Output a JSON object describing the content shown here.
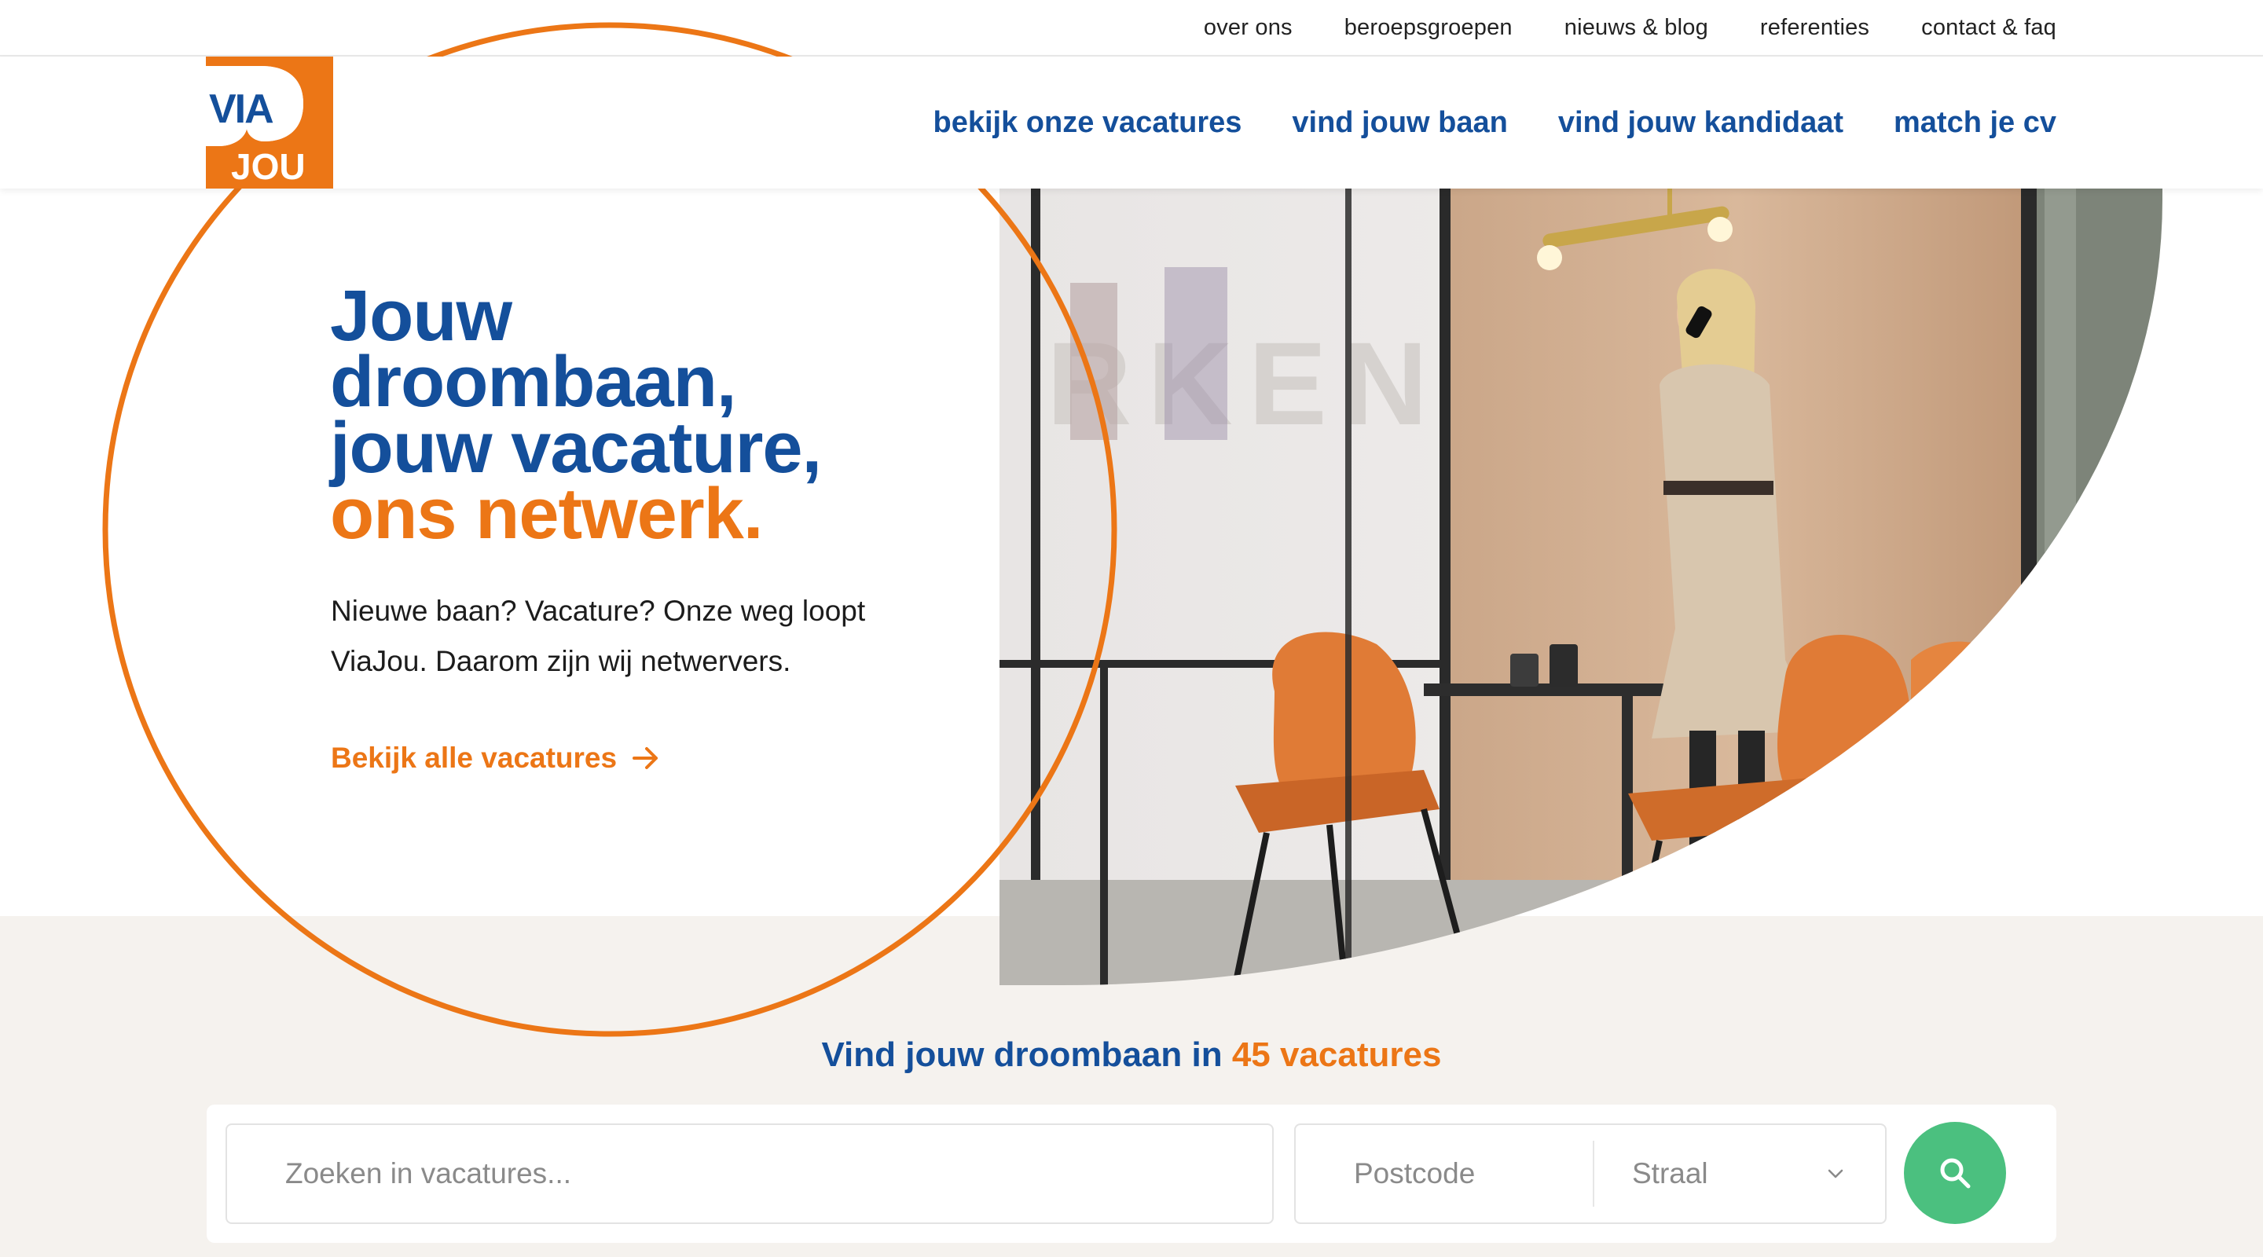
{
  "top_nav": [
    "over ons",
    "beroepsgroepen",
    "nieuws & blog",
    "referenties",
    "contact & faq"
  ],
  "main_nav": [
    "bekijk onze vacatures",
    "vind jouw baan",
    "vind jouw kandidaat",
    "match je cv"
  ],
  "logo": {
    "top": "VIA",
    "bottom": "JOU"
  },
  "hero": {
    "headline_blue": [
      "Jouw",
      "droombaan,",
      "jouw vacature,"
    ],
    "headline_orange": "ons netwerk.",
    "intro_line1": "Nieuwe baan? Vacature? Onze weg loopt",
    "intro_line2": "ViaJou. Daarom zijn wij netwervers.",
    "cta": "Bekijk alle vacatures"
  },
  "search": {
    "title_prefix": "Vind jouw droombaan in",
    "title_count": "45 vacatures",
    "query_placeholder": "Zoeken in vacatures...",
    "postcode_placeholder": "Postcode",
    "radius_placeholder": "Straal"
  },
  "colors": {
    "brand_blue": "#144f9b",
    "brand_orange": "#ec7616",
    "search_green": "#4bc07f",
    "beige_band": "#f5f2ee"
  },
  "icons": [
    "arrow-right-icon",
    "chevron-down-icon",
    "search-icon",
    "logo-icon"
  ]
}
